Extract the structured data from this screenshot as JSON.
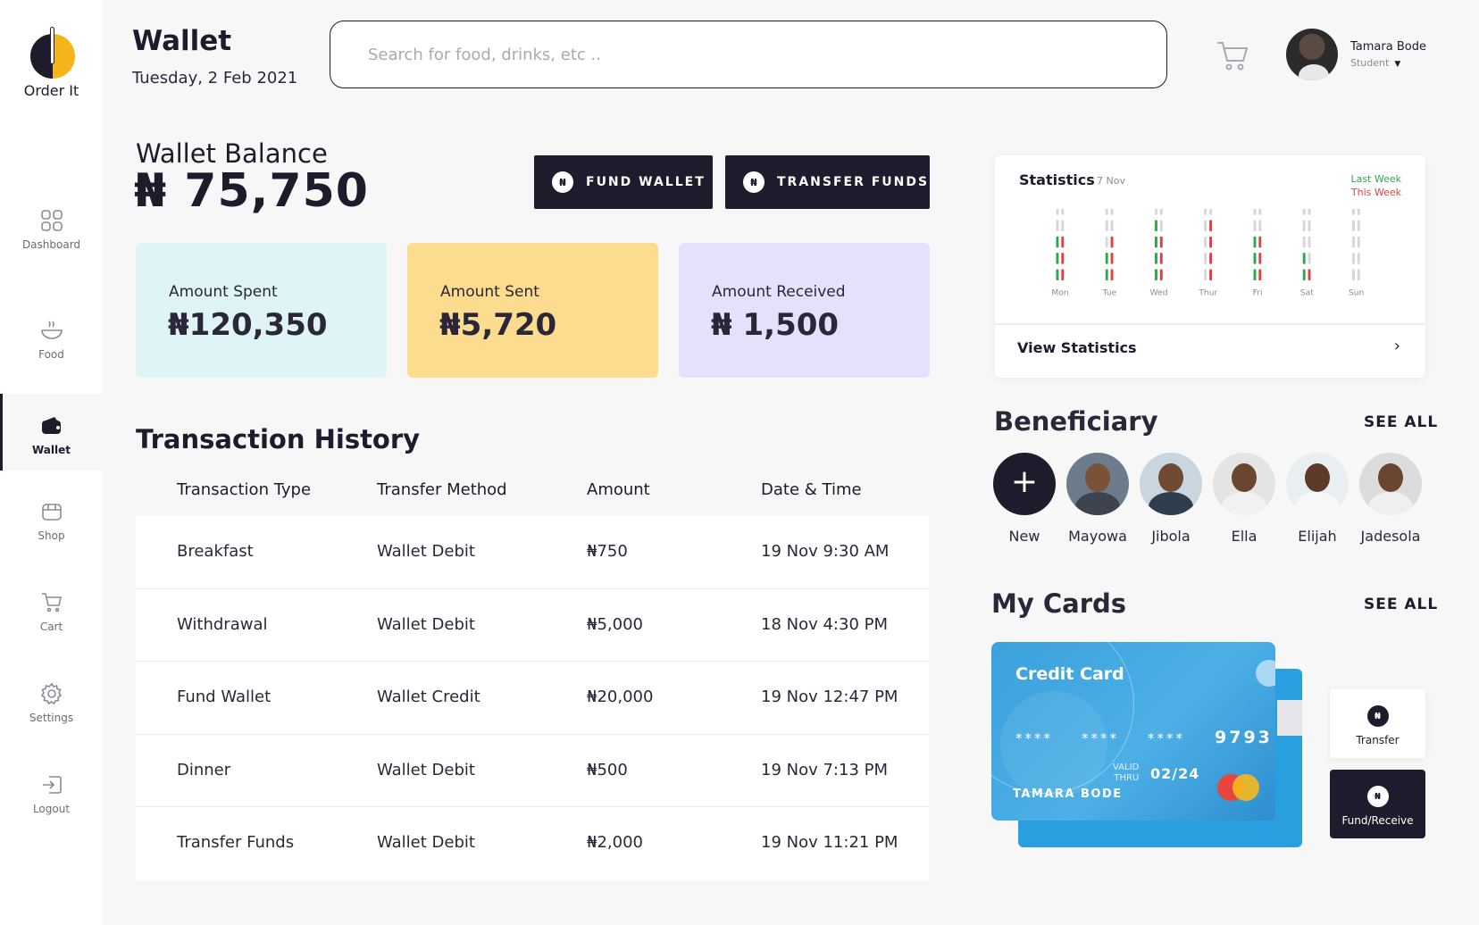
{
  "app": {
    "name": "Order It"
  },
  "nav": {
    "items": [
      {
        "label": "Dashboard",
        "icon": "grid-icon"
      },
      {
        "label": "Food",
        "icon": "bowl-icon"
      },
      {
        "label": "Wallet",
        "icon": "wallet-icon",
        "active": true
      },
      {
        "label": "Shop",
        "icon": "shop-icon"
      },
      {
        "label": "Cart",
        "icon": "cart-icon"
      },
      {
        "label": "Settings",
        "icon": "gear-icon"
      },
      {
        "label": "Logout",
        "icon": "logout-icon"
      }
    ]
  },
  "header": {
    "title": "Wallet",
    "date": "Tuesday, 2 Feb 2021",
    "search_placeholder": "Search for food, drinks, etc ..",
    "user": {
      "name": "Tamara Bode",
      "role": "Student"
    }
  },
  "wallet": {
    "balance_label": "Wallet Balance",
    "balance_value": "₦ 75,750",
    "fund_label": "FUND WALLET",
    "transfer_label": "TRANSFER FUNDS",
    "coin_symbol": "₦"
  },
  "summary": {
    "spent": {
      "label": "Amount Spent",
      "value": "₦120,350"
    },
    "sent": {
      "label": "Amount Sent",
      "value": "₦5,720"
    },
    "received": {
      "label": "Amount Received",
      "value": "₦ 1,500"
    }
  },
  "transactions": {
    "title": "Transaction History",
    "columns": [
      "Transaction Type",
      "Transfer Method",
      "Amount",
      "Date  & Time"
    ],
    "rows": [
      {
        "type": "Breakfast",
        "method": "Wallet Debit",
        "amount": "₦750",
        "datetime": "19 Nov  9:30 AM"
      },
      {
        "type": "Withdrawal",
        "method": "Wallet Debit",
        "amount": "₦5,000",
        "datetime": "18 Nov  4:30 PM"
      },
      {
        "type": "Fund Wallet",
        "method": "Wallet Credit",
        "amount": "₦20,000",
        "datetime": "19 Nov  12:47 PM"
      },
      {
        "type": "Dinner",
        "method": "Wallet Debit",
        "amount": "₦500",
        "datetime": "19 Nov  7:13 PM"
      },
      {
        "type": "Transfer Funds",
        "method": "Wallet Debit",
        "amount": "₦2,000",
        "datetime": "19 Nov  11:21 PM"
      }
    ]
  },
  "statistics": {
    "title": "Statistics",
    "date": "7 Nov",
    "legend_last": "Last Week",
    "legend_this": "This Week",
    "view_label": "View Statistics",
    "colors": {
      "last": "#2ea84f",
      "this": "#e0403f",
      "empty": "#d6d6db"
    }
  },
  "chart_data": {
    "type": "bar",
    "categories": [
      "Mon",
      "Tue",
      "Wed",
      "Thur",
      "Fri",
      "Sat",
      "Sun"
    ],
    "series": [
      {
        "name": "Last Week",
        "values": [
          3,
          2,
          4,
          0,
          3,
          2,
          0
        ]
      },
      {
        "name": "This Week",
        "values": [
          3,
          3,
          3,
          4,
          3,
          1,
          0
        ]
      }
    ],
    "ylim": [
      0,
      5
    ]
  },
  "beneficiary": {
    "title": "Beneficiary",
    "see_all": "SEE ALL",
    "people": [
      {
        "name": "New"
      },
      {
        "name": "Mayowa"
      },
      {
        "name": "Jibola"
      },
      {
        "name": "Ella"
      },
      {
        "name": "Elijah"
      },
      {
        "name": "Jadesola"
      }
    ]
  },
  "cards": {
    "title": "My Cards",
    "see_all": "SEE ALL",
    "card": {
      "label": "Credit Card",
      "mask": "****",
      "last4": "9793",
      "valid_line1": "VALID",
      "valid_line2": "THRU",
      "expiry": "02/24",
      "holder": "TAMARA BODE"
    },
    "actions": {
      "transfer": "Transfer",
      "fund": "Fund/Receive"
    }
  }
}
